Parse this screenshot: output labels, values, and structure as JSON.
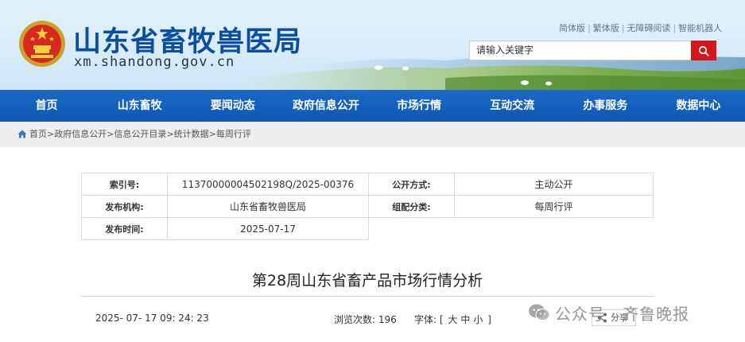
{
  "header": {
    "site_title": "山东省畜牧兽医局",
    "site_domain": "xm.shandong.gov.cn",
    "top_links": [
      "简体版",
      "繁体版",
      "无障碍阅读",
      "智能机器人"
    ],
    "search_placeholder": "请输入关键字"
  },
  "nav": {
    "items": [
      "首页",
      "山东畜牧",
      "要闻动态",
      "政府信息公开",
      "市场行情",
      "互动交流",
      "办事服务",
      "数据中心"
    ]
  },
  "breadcrumb": {
    "items": [
      "首页",
      "政府信息公开",
      "信息公开目录",
      "统计数据",
      "每周行评"
    ],
    "separator": ">"
  },
  "meta": {
    "index_label": "索引号:",
    "index_value": "11370000004502198Q/2025-00376",
    "open_mode_label": "公开方式:",
    "open_mode_value": "主动公开",
    "publisher_label": "发布机构:",
    "publisher_value": "山东省畜牧兽医局",
    "category_label": "组配分类:",
    "category_value": "每周行评",
    "pub_date_label": "发布时间:",
    "pub_date_value": "2025-07-17"
  },
  "article": {
    "title": "第28周山东省畜产品市场行情分析",
    "pub_time": "2025- 07- 17 09: 24: 23",
    "views_label": "浏览次数:",
    "views_value": "196",
    "font_label": "字体:",
    "font_open": "[",
    "font_sizes": [
      "大",
      "中",
      "小"
    ],
    "font_close": "]",
    "share_label": "分享"
  },
  "watermark": {
    "text": "公众号 · 齐鲁晚报"
  },
  "colors": {
    "nav_blue": "#1565c0",
    "title_blue": "#0c4fa0",
    "search_red": "#d6161c"
  }
}
